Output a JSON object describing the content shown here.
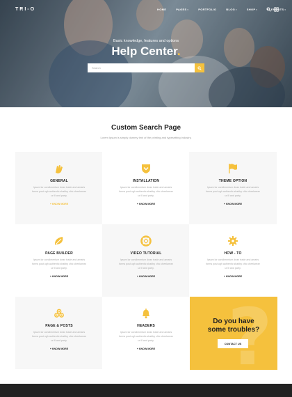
{
  "brand": {
    "logo": "TRI-O",
    "accent": "#f5c13d",
    "dark": "#222222"
  },
  "nav": {
    "items": [
      {
        "label": "HOME",
        "caret": false
      },
      {
        "label": "PAGES",
        "caret": true
      },
      {
        "label": "PORTFOLIO",
        "caret": false
      },
      {
        "label": "BLOG",
        "caret": true
      },
      {
        "label": "SHOP",
        "caret": true
      },
      {
        "label": "ELEMENTS",
        "caret": true
      }
    ],
    "icons": [
      "search-icon",
      "menu-icon"
    ]
  },
  "hero": {
    "kicker": "Basic knowledge, features and options",
    "title": "Help Center",
    "title_dot": ".",
    "search_placeholder": "Search",
    "search_icon": "search-icon"
  },
  "section": {
    "title": "Custom Search Page",
    "subtitle": "Lorem Ipsum is simply dummy text of the printing and typesetting industry."
  },
  "cards": [
    {
      "icon": "flex-icon",
      "title": "GENERAL",
      "text": "Ipsum lor condimentum dean trade and amaris forms post ugh authentic shabby chic cheekwear ur ill and party.",
      "link": "+ KNOW MORE",
      "active": true
    },
    {
      "icon": "shield-icon",
      "title": "INSTALLATION",
      "text": "Ipsum lor condimentum dean trade and amaris forms post ugh authentic shabby chic cheekwear ur ill and party.",
      "link": "+ KNOW MORE",
      "active": false
    },
    {
      "icon": "flag-icon",
      "title": "THEME OPTION",
      "text": "Ipsum lor condimentum dean trade and amaris forms post ugh authentic shabby chic cheekwear ur ill and party.",
      "link": "+ KNOW MORE",
      "active": false
    },
    {
      "icon": "leaf-icon",
      "title": "PAGE BUILDER",
      "text": "Ipsum lor condimentum dean trade and amaris forms post ugh authentic shabby chic cheekwear ur ill and party.",
      "link": "+ KNOW MORE",
      "active": false
    },
    {
      "icon": "lifebuoy-icon",
      "title": "VIDEO TUTORIAL",
      "text": "Ipsum lor condimentum dean trade and amaris forms post ugh authentic shabby chic cheekwear ur ill and party.",
      "link": "+ KNOW MORE",
      "active": false
    },
    {
      "icon": "gear-icon",
      "title": "HOW - TO",
      "text": "Ipsum lor condimentum dean trade and amaris forms post ugh authentic shabby chic cheekwear ur ill and party.",
      "link": "+ KNOW MORE",
      "active": false
    },
    {
      "icon": "coins-icon",
      "title": "PAGE & POSTS",
      "text": "Ipsum lor condimentum dean trade and amaris forms post ugh authentic shabby chic cheekwear ur ill and party.",
      "link": "+ KNOW MORE",
      "active": false
    },
    {
      "icon": "bell-icon",
      "title": "HEADERS",
      "text": "Ipsum lor condimentum dean trade and amaris forms post ugh authentic shabby chic cheekwear ur ill and party.",
      "link": "+ KNOW MORE",
      "active": false
    }
  ],
  "cta": {
    "title_line1": "Do you have",
    "title_line2": "some troubles?",
    "button": "CONTACT US",
    "bg_glyph": "?"
  }
}
